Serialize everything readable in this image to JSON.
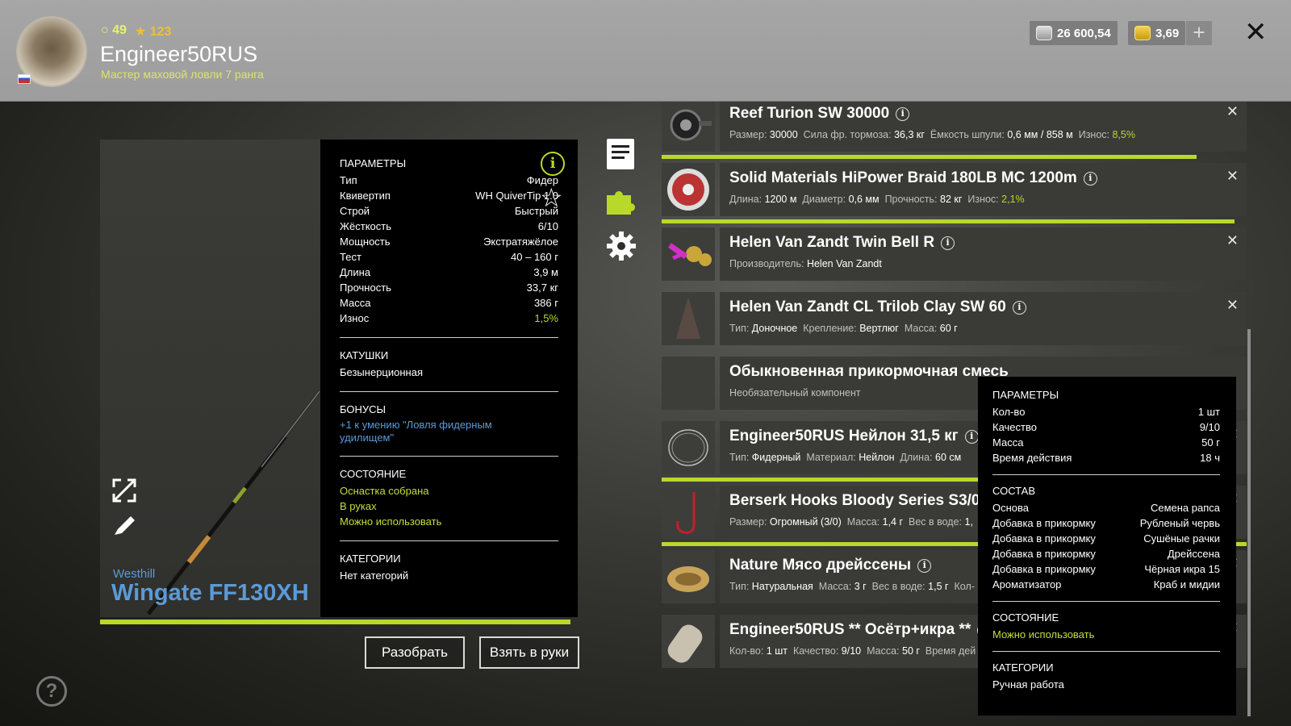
{
  "header": {
    "level": "49",
    "stars": "123",
    "username": "Engineer50RUS",
    "rank": "Мастер маховой ловли 7 ранга",
    "silver": "26 600,54",
    "gold": "3,69",
    "plus_label": "+",
    "close_label": "✕"
  },
  "rod": {
    "brand": "Westhill",
    "title": "Wingate FF130XH",
    "params_title": "ПАРАМЕТРЫ",
    "params": [
      {
        "label": "Тип",
        "value": "Фидер"
      },
      {
        "label": "Квивертип",
        "value": "WH QuiverTip 1.0"
      },
      {
        "label": "Строй",
        "value": "Быстрый"
      },
      {
        "label": "Жёсткость",
        "value": "6/10"
      },
      {
        "label": "Мощность",
        "value": "Экстратяжёлое"
      },
      {
        "label": "Тест",
        "value": "40 – 160 г"
      },
      {
        "label": "Длина",
        "value": "3,9 м"
      },
      {
        "label": "Прочность",
        "value": "33,7 кг"
      },
      {
        "label": "Масса",
        "value": "386 г"
      },
      {
        "label": "Износ",
        "value": "1,5%"
      }
    ],
    "reels_title": "КАТУШКИ",
    "reels_value": "Безынерционная",
    "bonus_title": "БОНУСЫ",
    "bonus_value": "+1 к умению \"Ловля фидерным удилищем\"",
    "state_title": "СОСТОЯНИЕ",
    "state_values": [
      "Оснастка собрана",
      "В руках",
      "Можно использовать"
    ],
    "categories_title": "КАТЕГОРИИ",
    "categories_value": "Нет категорий",
    "durability": 0.985
  },
  "buttons": {
    "disassemble": "Разобрать",
    "take": "Взять в руки"
  },
  "items": [
    {
      "name": "Reef Turion SW 30000",
      "desc": [
        [
          "Размер:",
          "30000"
        ],
        [
          "Сила фр. тормоза:",
          "36,3 кг"
        ],
        [
          "Ёмкость шпули:",
          "0,6 мм / 858 м"
        ],
        [
          "Износ:",
          "8,5%"
        ]
      ],
      "wear_green": true,
      "bar": 0.915,
      "icon": "reel-icon"
    },
    {
      "name": "Solid Materials HiPower Braid 180LB MC 1200m",
      "desc": [
        [
          "Длина:",
          "1200 м"
        ],
        [
          "Диаметр:",
          "0,6 мм"
        ],
        [
          "Прочность:",
          "82 кг"
        ],
        [
          "Износ:",
          "2,1%"
        ]
      ],
      "wear_green": true,
      "bar": 0.979,
      "icon": "line-spool-icon"
    },
    {
      "name": "Helen Van Zandt Twin Bell R",
      "desc": [
        [
          "Производитель:",
          "Helen Van Zandt"
        ]
      ],
      "icon": "bell-icon"
    },
    {
      "name": "Helen Van Zandt CL Trilob Clay SW 60",
      "desc": [
        [
          "Тип:",
          "Доночное"
        ],
        [
          "Крепление:",
          "Вертлюг"
        ],
        [
          "Масса:",
          "60 г"
        ]
      ],
      "icon": "sinker-icon"
    },
    {
      "name": "Обыкновенная прикормочная смесь",
      "desc": [
        [
          "Необязательный компонент",
          ""
        ]
      ],
      "icon": "empty-slot"
    },
    {
      "name": "Engineer50RUS Нейлон 31,5 кг",
      "desc": [
        [
          "Тип:",
          "Фидерный"
        ],
        [
          "Материал:",
          "Нейлон"
        ],
        [
          "Длина:",
          "60 см"
        ]
      ],
      "bar": 0.98,
      "icon": "leader-icon"
    },
    {
      "name": "Berserk Hooks Bloody Series S3/0",
      "desc": [
        [
          "Размер:",
          "Огромный (3/0)"
        ],
        [
          "Масса:",
          "1,4 г"
        ],
        [
          "Вес в воде:",
          "1,"
        ]
      ],
      "bar": 1.0,
      "icon": "hook-icon"
    },
    {
      "name": "Nature Мясо дрейссены",
      "desc": [
        [
          "Тип:",
          "Натуральная"
        ],
        [
          "Масса:",
          "3 г"
        ],
        [
          "Вес в воде:",
          "1,5 г"
        ],
        [
          "Кол-",
          ""
        ]
      ],
      "icon": "mussel-icon"
    },
    {
      "name": "Engineer50RUS ** Осётр+икра **",
      "desc": [
        [
          "Кол-во:",
          "1 шт"
        ],
        [
          "Качество:",
          "9/10"
        ],
        [
          "Масса:",
          "50 г"
        ],
        [
          "Время дей",
          ""
        ]
      ],
      "icon": "bait-ball-icon"
    }
  ],
  "tooltip": {
    "params_title": "ПАРАМЕТРЫ",
    "params": [
      {
        "label": "Кол-во",
        "value": "1 шт"
      },
      {
        "label": "Качество",
        "value": "9/10"
      },
      {
        "label": "Масса",
        "value": "50 г"
      },
      {
        "label": "Время действия",
        "value": "18 ч"
      }
    ],
    "composition_title": "СОСТАВ",
    "composition": [
      {
        "label": "Основа",
        "value": "Семена рапса"
      },
      {
        "label": "Добавка в прикормку",
        "value": "Рубленый червь"
      },
      {
        "label": "Добавка в прикормку",
        "value": "Сушёные рачки"
      },
      {
        "label": "Добавка в прикормку",
        "value": "Дрейссена"
      },
      {
        "label": "Добавка в прикормку",
        "value": "Чёрная икра 15"
      },
      {
        "label": "Ароматизатор",
        "value": "Краб и мидии"
      }
    ],
    "state_title": "СОСТОЯНИЕ",
    "state_value": "Можно использовать",
    "categories_title": "КАТЕГОРИИ",
    "categories_value": "Ручная работа"
  },
  "colors": {
    "accent": "#b8d92a",
    "link_blue": "#5b9ad7"
  }
}
